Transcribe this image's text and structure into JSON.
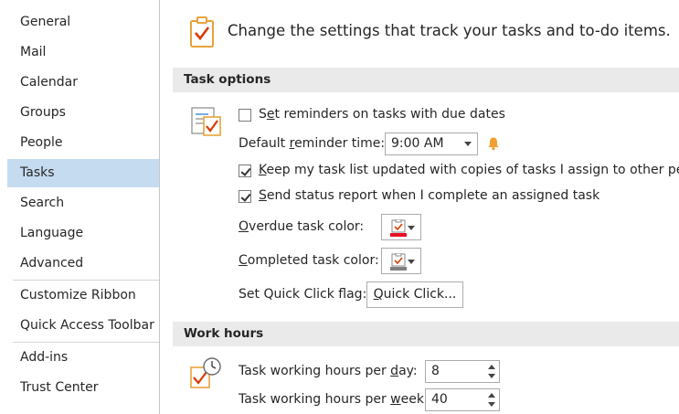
{
  "sidebar": {
    "items": [
      {
        "label": "General"
      },
      {
        "label": "Mail"
      },
      {
        "label": "Calendar"
      },
      {
        "label": "Groups"
      },
      {
        "label": "People"
      },
      {
        "label": "Tasks",
        "selected": true
      },
      {
        "label": "Search"
      },
      {
        "label": "Language"
      },
      {
        "label": "Advanced"
      },
      {
        "label": "Customize Ribbon"
      },
      {
        "label": "Quick Access Toolbar"
      },
      {
        "label": "Add-ins"
      },
      {
        "label": "Trust Center"
      }
    ]
  },
  "header": {
    "text": "Change the settings that track your tasks and to-do items.",
    "icon": "clipboard-check-icon"
  },
  "task_options": {
    "title": "Task options",
    "set_reminders": {
      "pre": "S",
      "key": "e",
      "post": "t reminders on tasks with due dates",
      "checked": false
    },
    "default_reminder": {
      "pre": "Default ",
      "key": "r",
      "post": "eminder time:",
      "value": "9:00 AM"
    },
    "keep_updated": {
      "pre": "",
      "key": "K",
      "post": "eep my task list updated with copies of tasks I assign to other people",
      "checked": true
    },
    "send_status": {
      "pre": "",
      "key": "S",
      "post": "end status report when I complete an assigned task",
      "checked": true
    },
    "overdue_color": {
      "pre": "",
      "key": "O",
      "post": "verdue task color:",
      "color": "#e81123"
    },
    "completed_color": {
      "pre": "",
      "key": "C",
      "post": "ompleted task color:",
      "color": "#7f7f7f"
    },
    "quick_click": {
      "label": "Set Quick Click flag:",
      "button_key": "Q",
      "button_post": "uick Click..."
    }
  },
  "work_hours": {
    "title": "Work hours",
    "per_day": {
      "pre": "Task working hours per ",
      "key": "d",
      "post": "ay:",
      "value": "8"
    },
    "per_week": {
      "pre": "Task working hours per ",
      "key": "w",
      "post": "eek:",
      "value": "40"
    }
  },
  "colors": {
    "selected_bg": "#c5dcf0",
    "section_bg": "#eaeaea",
    "bell": "#f0a030",
    "clipboard": "#e8a33a",
    "check_red": "#d83b01"
  }
}
